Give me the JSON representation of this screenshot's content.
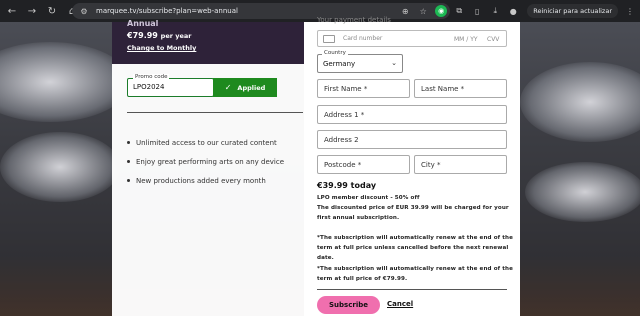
{
  "browser": {
    "url": "marquee.tv/subscribe?plan=web-annual",
    "update_label": "Reiniciar para actualizar"
  },
  "plan": {
    "name": "Annual",
    "price": "€79.99",
    "per": "per year",
    "change_link": "Change to Monthly"
  },
  "promo": {
    "label": "Promo code",
    "value": "LPO2024",
    "applied_label": "Applied"
  },
  "features": [
    "Unlimited access to our curated content",
    "Enjoy great performing arts on any device",
    "New productions added every month"
  ],
  "payment": {
    "heading": "Your payment details",
    "card_placeholder": "Card number",
    "expiry_placeholder": "MM / YY",
    "cvv_placeholder": "CVV",
    "country_label": "Country",
    "country_value": "Germany",
    "first_name": "First Name *",
    "last_name": "Last Name *",
    "address1": "Address 1 *",
    "address2": "Address 2",
    "postcode": "Postcode *",
    "city": "City *"
  },
  "summary": {
    "total": "€39.99 today",
    "discount": "LPO member discount - 50% off",
    "charge_line1": "The discounted price of EUR 39.99 will be charged for your",
    "charge_line2": "first annual subscription.",
    "renew1_line1": "*The subscription will automatically renew at the end of the",
    "renew1_line2": "term at full price unless cancelled before the next renewal",
    "renew1_line3": "date.",
    "renew2_line1": "*The subscription will automatically renew at the end of the",
    "renew2_line2": "term at full price of €79.99."
  },
  "actions": {
    "subscribe": "Subscribe",
    "cancel": "Cancel"
  },
  "colors": {
    "accent_pink": "#f06fae",
    "applied_green": "#1e8a1e",
    "plan_header": "#2e2239"
  }
}
